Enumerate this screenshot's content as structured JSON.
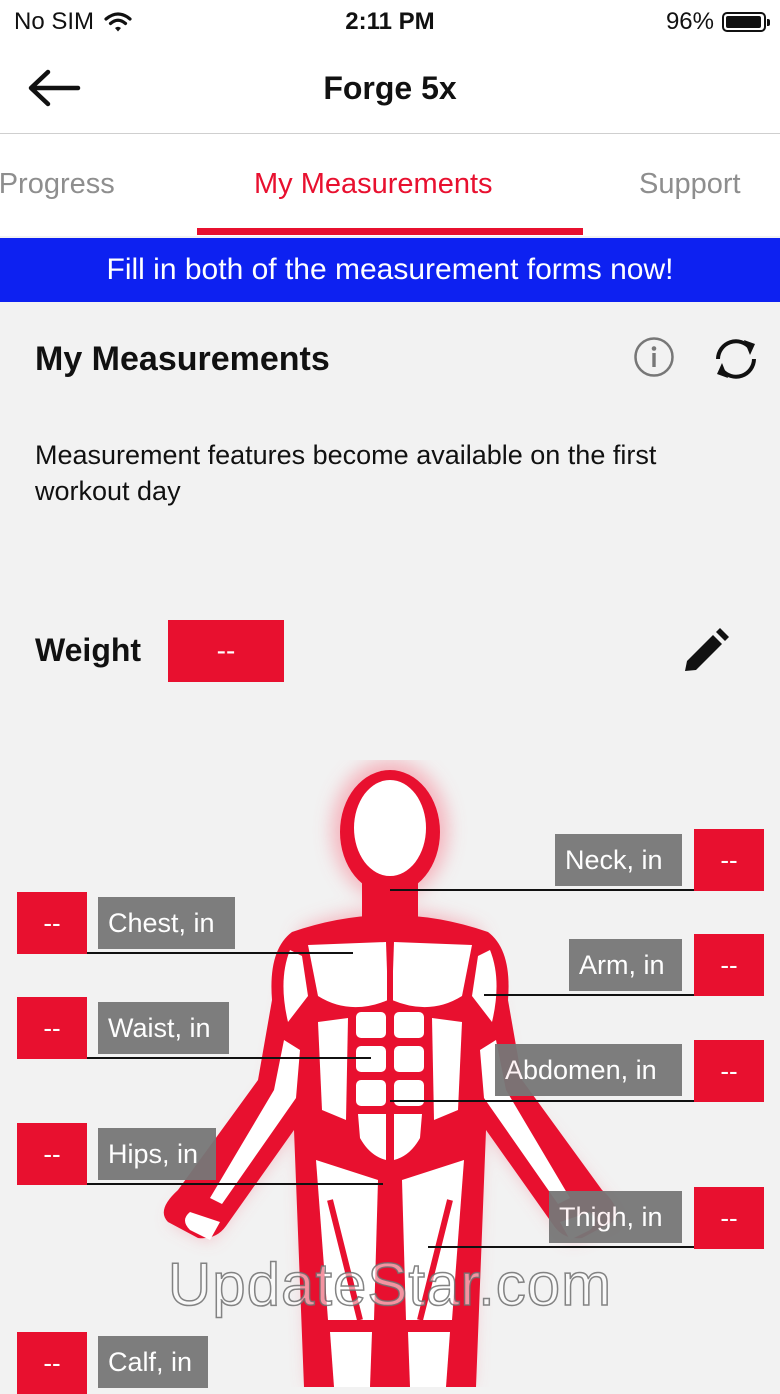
{
  "status_bar": {
    "carrier": "No SIM",
    "time": "2:11 PM",
    "battery": "96%",
    "battery_level": 0.96
  },
  "nav": {
    "title": "Forge 5x"
  },
  "tabs": [
    {
      "label": "My Progress",
      "active": false
    },
    {
      "label": "My Measurements",
      "active": true
    },
    {
      "label": "Support",
      "active": false
    }
  ],
  "banner": {
    "text": "Fill in both of the measurement forms now!"
  },
  "section": {
    "title": "My Measurements",
    "description": "Measurement features become available on the first workout day"
  },
  "weight": {
    "label": "Weight",
    "value": "--"
  },
  "measurements": {
    "neck": {
      "label": "Neck, in",
      "value": "--"
    },
    "chest": {
      "label": "Chest, in",
      "value": "--"
    },
    "arm": {
      "label": "Arm, in",
      "value": "--"
    },
    "waist": {
      "label": "Waist, in",
      "value": "--"
    },
    "abdomen": {
      "label": "Abdomen, in",
      "value": "--"
    },
    "hips": {
      "label": "Hips, in",
      "value": "--"
    },
    "thigh": {
      "label": "Thigh, in",
      "value": "--"
    },
    "calf": {
      "label": "Calf, in",
      "value": "--"
    }
  },
  "watermark": "UpdateStar.com",
  "colors": {
    "accent": "#e8102f",
    "banner": "#0d21f1",
    "label_bg": "#777777"
  }
}
